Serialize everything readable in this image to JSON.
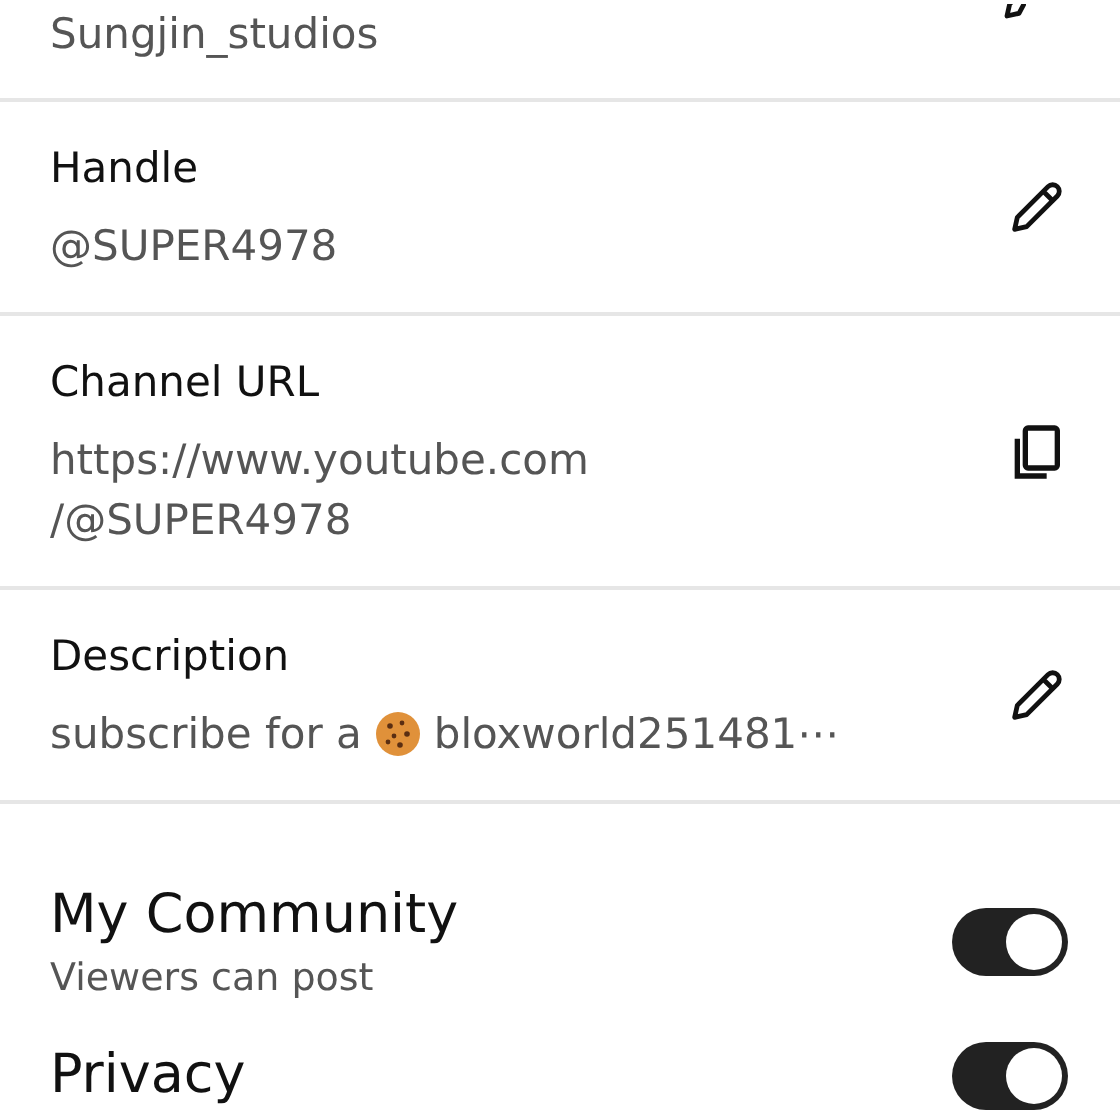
{
  "fields": [
    {
      "kind": "edit",
      "value_lines": [
        "Sungjin_studios"
      ]
    },
    {
      "kind": "edit",
      "label": "Handle",
      "value_lines": [
        "@SUPER4978"
      ]
    },
    {
      "kind": "copy",
      "label": "Channel URL",
      "value_lines": [
        "https://www.youtube.com",
        "/@SUPER4978"
      ]
    },
    {
      "kind": "edit",
      "label": "Description",
      "value_before": "subscribe for a",
      "value_after": "bloxworld251481⋯"
    }
  ],
  "settings": [
    {
      "title": "My Community",
      "subtitle": "Viewers can post",
      "on": true
    },
    {
      "title": "Privacy",
      "on": true
    }
  ]
}
